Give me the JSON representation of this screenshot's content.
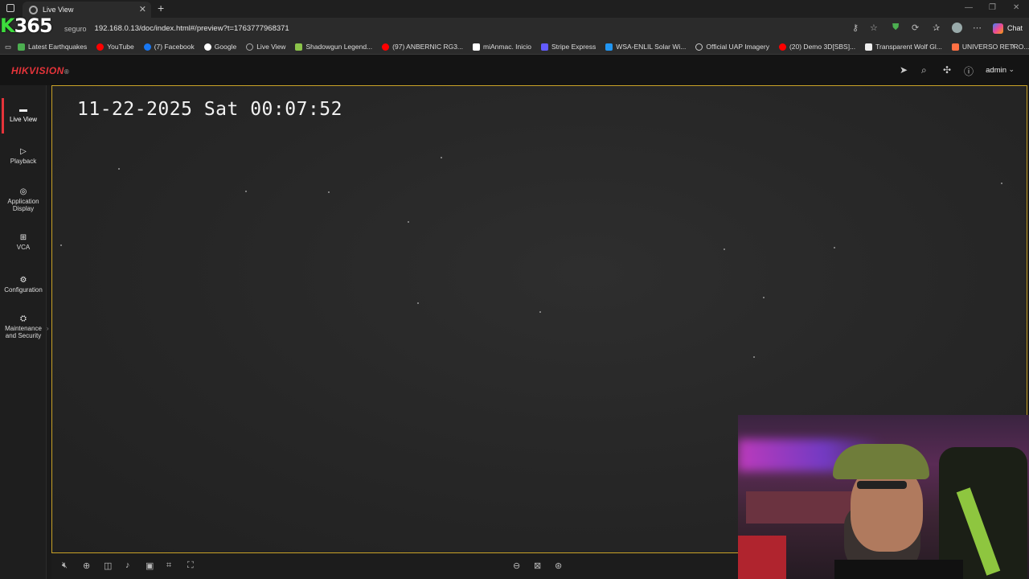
{
  "browser": {
    "tab_title": "Live View",
    "address_prefix": "seguro",
    "url": "192.168.0.13/doc/index.html#/preview?t=1763777968371",
    "chat_label": "Chat",
    "overlay_logo": "365",
    "overlay_logo_prefix": "K",
    "bookmarks": [
      {
        "label": "Latest Earthquakes",
        "color": "#4caf50"
      },
      {
        "label": "YouTube",
        "color": "#ff0000"
      },
      {
        "label": "(7) Facebook",
        "color": "#1877f2"
      },
      {
        "label": "Google",
        "color": "#ffffff"
      },
      {
        "label": "Live View",
        "color": "#888888"
      },
      {
        "label": "Shadowgun Legend...",
        "color": "#8bc34a"
      },
      {
        "label": "(97) ANBERNIC RG3...",
        "color": "#ff0000"
      },
      {
        "label": "miAnmac. Inicio",
        "color": "#ffffff"
      },
      {
        "label": "Stripe Express",
        "color": "#635bff"
      },
      {
        "label": "WSA-ENLIL Solar Wi...",
        "color": "#2196f3"
      },
      {
        "label": "Official UAP Imagery",
        "color": "#cccccc"
      },
      {
        "label": "(20) Demo 3D[SBS]...",
        "color": "#ff0000"
      },
      {
        "label": "Transparent Wolf Gl...",
        "color": "#eeeeee"
      },
      {
        "label": "UNIVERSO RETRO...",
        "color": "#ff7043"
      }
    ]
  },
  "app": {
    "brand": "HIKVISION",
    "brand_mark": "®",
    "user": "admin",
    "accent_color": "#e5343a",
    "nav": [
      {
        "label": "Live View",
        "icon": "monitor-icon",
        "active": true
      },
      {
        "label": "Playback",
        "icon": "playback-icon",
        "active": false
      },
      {
        "label": "Application Display",
        "icon": "application-icon",
        "active": false
      },
      {
        "label": "VCA",
        "icon": "vca-grid-icon",
        "active": false
      },
      {
        "label": "Configuration",
        "icon": "gear-icon",
        "active": false
      },
      {
        "label": "Maintenance and Security",
        "icon": "maintenance-icon",
        "active": false
      }
    ]
  },
  "video": {
    "osd_timestamp": "11-22-2025 Sat 00:07:52"
  }
}
